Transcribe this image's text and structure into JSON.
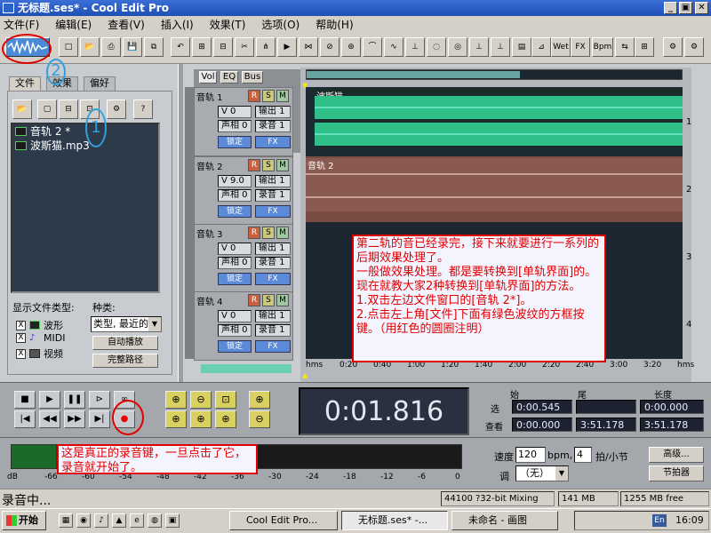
{
  "window": {
    "title": "无标题.ses* - Cool Edit Pro",
    "min": "_",
    "max": "▣",
    "close": "✕"
  },
  "menu": [
    "文件(F)",
    "编辑(E)",
    "查看(V)",
    "插入(I)",
    "效果(T)",
    "选项(O)",
    "帮助(H)"
  ],
  "toolbar": {
    "wet_label": "Wet",
    "fx_label": "FX",
    "bpm_label": "Bpm"
  },
  "left_panel": {
    "tabs": [
      "文件",
      "效果",
      "偏好"
    ],
    "files": [
      "音轨  2 *",
      "波斯猫.mp3"
    ],
    "filetype_label": "显示文件类型:",
    "sort_label": "种类:",
    "types": [
      "波形",
      "MIDI",
      "视频"
    ],
    "check_mark": "X",
    "sort_select": "类型, 最近的",
    "autoplay": "自动播放",
    "fullpath": "完整路径"
  },
  "track_view_tabs": [
    "Vol",
    "EQ",
    "Bus"
  ],
  "tracks": [
    {
      "name": "音轨 1",
      "vol": "V 0",
      "pan": "声相 0",
      "out": "输出 1",
      "rec": "录音 1",
      "lock": "锁定",
      "fx": "FX",
      "clip": "波斯猫",
      "num": "1"
    },
    {
      "name": "音轨 2",
      "vol": "V 9.0",
      "pan": "声相 0",
      "out": "输出 1",
      "rec": "录音 1",
      "lock": "锁定",
      "fx": "FX",
      "clip": "音轨 2",
      "num": "2"
    },
    {
      "name": "音轨 3",
      "vol": "V 0",
      "pan": "声相 0",
      "out": "输出 1",
      "rec": "录音 1",
      "lock": "锁定",
      "fx": "FX",
      "clip": "",
      "num": "3"
    },
    {
      "name": "音轨 4",
      "vol": "V 0",
      "pan": "声相 0",
      "out": "输出 1",
      "rec": "录音 1",
      "lock": "锁定",
      "fx": "FX",
      "clip": "",
      "num": "4"
    }
  ],
  "rsm": [
    "R",
    "S",
    "M"
  ],
  "ruler": [
    "hms",
    "0:20",
    "0:40",
    "1:00",
    "1:20",
    "1:40",
    "2:00",
    "2:20",
    "2:40",
    "3:00",
    "3:20",
    "hms"
  ],
  "annotation_main": "第二轨的音已经录完，接下来就要进行一系列的后期效果处理了。\n一般做效果处理。都是要转换到[单轨界面]的。现在就教大家2种转换到[单轨界面]的方法。\n1.双击左边文件窗口的[音轨 2*]。\n2.点击左上角[文件]下面有绿色波纹的方框按键。（用红色的圆圈注明）",
  "annotation_record": "这是真正的录音键，一旦点击了它，录音就开始了。",
  "markers": {
    "one": "1",
    "two": "2"
  },
  "transport": {
    "time": "0:01.816",
    "headers": [
      "始",
      "尾",
      "长度"
    ],
    "sel_label": "选",
    "view_label": "查看",
    "sel": [
      "0:00.545",
      "",
      "0:00.000"
    ],
    "view": [
      "0:00.000",
      "3:51.178",
      "3:51.178"
    ]
  },
  "tempo": {
    "label": "速度",
    "value": "120",
    "unit": "bpm,",
    "beats": "4",
    "beats_unit": "拍/小节",
    "key_label": "调",
    "key_value": "（无）",
    "advanced": "高级...",
    "metronome": "节拍器"
  },
  "meter_scale": [
    "dB",
    "-66",
    "-60",
    "-54",
    "-48",
    "-42",
    "-36",
    "-30",
    "-24",
    "-18",
    "-12",
    "-6",
    "0"
  ],
  "status": {
    "left": "录音中...",
    "format": "44100 ?32-bit Mixing",
    "mem": "141 MB",
    "disk": "1255 MB free"
  },
  "taskbar": {
    "start": "开始",
    "tasks": [
      "Cool Edit Pro...",
      "无标题.ses* -...",
      "未命名 - 画图"
    ],
    "lang": "En",
    "clock": "16:09"
  }
}
